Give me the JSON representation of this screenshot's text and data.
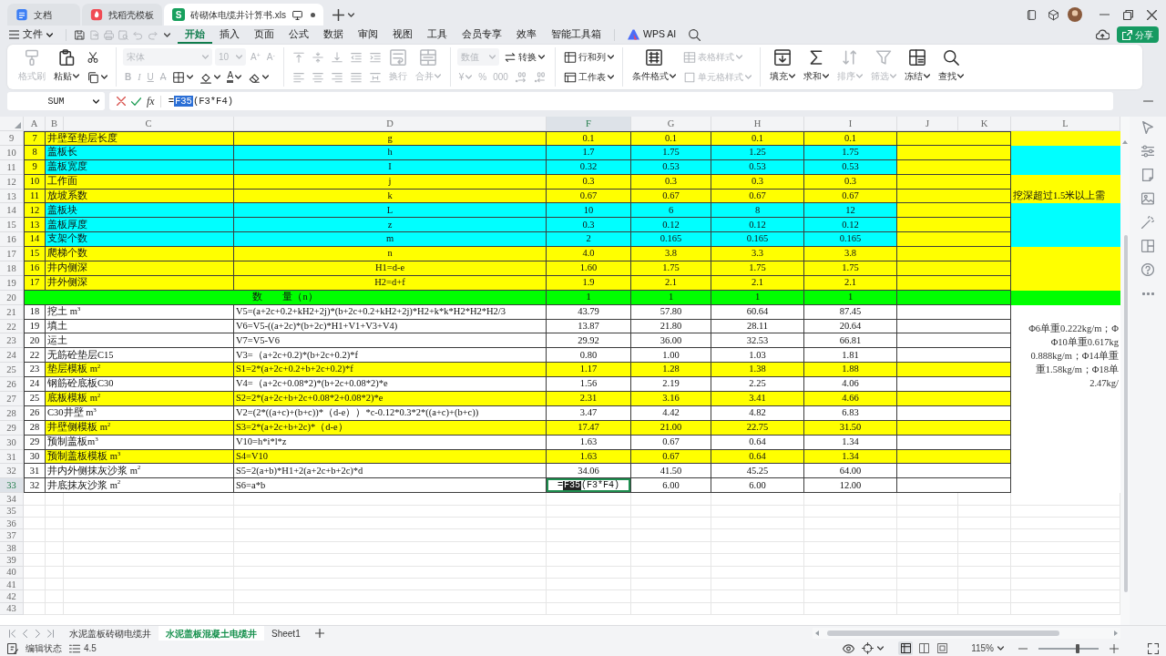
{
  "window_tabs": [
    {
      "kind": "doc",
      "label": "文档",
      "selected": false
    },
    {
      "kind": "template",
      "label": "找稻壳模板",
      "selected": false
    },
    {
      "kind": "sheet",
      "badge": "S",
      "label": "砖砌体电缆井计算书.xls",
      "selected": true
    }
  ],
  "menu": {
    "file": "文件",
    "quick_access": [
      {
        "disabled": false
      },
      {
        "disabled": true
      },
      {
        "disabled": true
      },
      {
        "disabled": true
      },
      {
        "disabled": true
      },
      {
        "disabled": true
      }
    ],
    "tabs": [
      {
        "label": "开始",
        "selected": true
      },
      {
        "label": "插入",
        "selected": false
      },
      {
        "label": "页面",
        "selected": false
      },
      {
        "label": "公式",
        "selected": false
      },
      {
        "label": "数据",
        "selected": false
      },
      {
        "label": "审阅",
        "selected": false
      },
      {
        "label": "视图",
        "selected": false
      },
      {
        "label": "工具",
        "selected": false
      },
      {
        "label": "会员专享",
        "selected": false
      },
      {
        "label": "效率",
        "selected": false
      },
      {
        "label": "智能工具箱",
        "selected": false
      }
    ],
    "ai": "WPS AI",
    "share": "分享"
  },
  "ribbon": [
    {
      "parts": [
        {
          "kind": "large",
          "label": "格式刷",
          "disabled": true
        },
        {
          "kind": "large",
          "label": "粘贴",
          "disabled": false,
          "dropdown": true
        },
        {
          "kind": "stack",
          "top": [
            {
              "kind": "icon",
              "disabled": false
            }
          ],
          "bottom": [
            {
              "kind": "icon",
              "disabled": false,
              "dropdown": true
            }
          ]
        }
      ]
    },
    {
      "parts": [
        {
          "kind": "stack",
          "top": [
            {
              "kind": "field",
              "value": "宋体",
              "disabled": true,
              "dropdown": true
            },
            {
              "kind": "field",
              "value": "10",
              "disabled": true,
              "dropdown": true
            },
            {
              "kind": "glyph",
              "text": "A$^{+}$",
              "disabled": true
            },
            {
              "kind": "glyph",
              "text": "A$^{-}$",
              "disabled": true
            }
          ],
          "bottom": [
            {
              "kind": "glyph",
              "text": "B",
              "disabled": true
            },
            {
              "kind": "glyph",
              "text": "I",
              "disabled": true
            },
            {
              "kind": "glyph",
              "text": "U",
              "disabled": true
            },
            {
              "kind": "glyph",
              "text": "A",
              "disabled": true
            },
            {
              "kind": "icon",
              "disabled": false,
              "dropdown": true
            },
            {
              "kind": "icon",
              "disabled": false,
              "dropdown": true
            },
            {
              "kind": "glyph",
              "text": "A",
              "disabled": false,
              "dropdown": true
            },
            {
              "kind": "icon",
              "disabled": false,
              "dropdown": true
            }
          ]
        }
      ]
    },
    {
      "parts": [
        {
          "kind": "stack",
          "top": [
            {
              "kind": "icon",
              "disabled": true
            },
            {
              "kind": "icon",
              "disabled": true
            },
            {
              "kind": "icon",
              "disabled": true
            },
            {
              "kind": "icon",
              "disabled": true
            },
            {
              "kind": "icon",
              "disabled": true
            }
          ],
          "bottom": [
            {
              "kind": "icon",
              "disabled": true
            },
            {
              "kind": "icon",
              "disabled": true
            },
            {
              "kind": "icon",
              "disabled": true
            },
            {
              "kind": "icon",
              "disabled": true
            },
            {
              "kind": "icon",
              "disabled": true
            }
          ]
        },
        {
          "kind": "large",
          "label": "换行",
          "disabled": true
        },
        {
          "kind": "large",
          "label": "合并",
          "disabled": true,
          "dropdown": true
        }
      ]
    },
    {
      "parts": [
        {
          "kind": "stack",
          "top": [
            {
              "kind": "field",
              "value": "数值",
              "disabled": true,
              "dropdown": true
            },
            {
              "kind": "small",
              "label": "转换",
              "disabled": false,
              "dropdown": true
            }
          ],
          "bottom": [
            {
              "kind": "glyph",
              "text": "¥",
              "disabled": true,
              "dropdown": true
            },
            {
              "kind": "glyph",
              "text": "%",
              "disabled": true
            },
            {
              "kind": "glyph",
              "text": "000",
              "disabled": true
            },
            {
              "kind": "icon",
              "disabled": true
            },
            {
              "kind": "icon",
              "disabled": true
            }
          ]
        }
      ]
    },
    {
      "parts": [
        {
          "kind": "stack",
          "top": [
            {
              "kind": "small",
              "label": "行和列",
              "disabled": false,
              "dropdown": true
            }
          ],
          "bottom": [
            {
              "kind": "small",
              "label": "工作表",
              "disabled": false,
              "dropdown": true
            }
          ]
        }
      ]
    },
    {
      "parts": [
        {
          "kind": "large",
          "label": "条件格式",
          "disabled": false,
          "dropdown": true
        },
        {
          "kind": "stack",
          "top": [
            {
              "kind": "small",
              "label": "表格样式",
              "disabled": true,
              "dropdown": true
            }
          ],
          "bottom": [
            {
              "kind": "small",
              "label": "单元格样式",
              "disabled": true,
              "dropdown": true
            }
          ]
        }
      ]
    },
    {
      "parts": [
        {
          "kind": "large",
          "label": "填充",
          "disabled": false,
          "dropdown": true
        },
        {
          "kind": "large",
          "label": "求和",
          "disabled": false,
          "dropdown": true
        },
        {
          "kind": "large",
          "label": "排序",
          "disabled": true,
          "dropdown": true
        },
        {
          "kind": "large",
          "label": "筛选",
          "disabled": true,
          "dropdown": true
        },
        {
          "kind": "large",
          "label": "冻结",
          "disabled": false,
          "dropdown": true
        },
        {
          "kind": "large",
          "label": "查找",
          "disabled": false,
          "dropdown": true
        }
      ]
    }
  ],
  "formula_bar": {
    "name_box": "SUM",
    "fx": "fx",
    "formula": [
      {
        "text": "=",
        "selected": false
      },
      {
        "text": "F35",
        "selected": true
      },
      {
        "text": "(F3*F4)",
        "selected": false
      }
    ]
  },
  "columns": [
    {
      "label": "A",
      "selected": false
    },
    {
      "label": "B",
      "selected": false
    },
    {
      "label": "C",
      "selected": false
    },
    {
      "label": "D",
      "selected": false
    },
    {
      "label": "F",
      "selected": true
    },
    {
      "label": "G",
      "selected": false
    },
    {
      "label": "H",
      "selected": false
    },
    {
      "label": "I",
      "selected": false
    },
    {
      "label": "J",
      "selected": false
    },
    {
      "label": "K",
      "selected": false
    },
    {
      "label": "L",
      "selected": false
    }
  ],
  "rows": [
    {
      "kind": "parameter",
      "row": "9",
      "selected": false,
      "no": "7",
      "item": "井壁至垫层长度",
      "symbol": "g",
      "values": [
        "0.1",
        "0.1",
        "0.1",
        "0.1"
      ],
      "color": "#ffff00",
      "edge": {
        "color": "#ffff00"
      },
      "side": {
        "color": "#ffff00"
      }
    },
    {
      "kind": "parameter",
      "row": "10",
      "selected": false,
      "no": "8",
      "item": "盖板长",
      "symbol": "h",
      "values": [
        "1.7",
        "1.75",
        "1.25",
        "1.75"
      ],
      "color": "#00ffff",
      "edge": {
        "color": "#ffff00"
      },
      "side": {
        "color": "#00ffff"
      }
    },
    {
      "kind": "parameter",
      "row": "11",
      "selected": false,
      "no": "9",
      "item": "盖板宽度",
      "symbol": "I",
      "values": [
        "0.32",
        "0.53",
        "0.53",
        "0.53"
      ],
      "color": "#00ffff",
      "edge": {
        "color": "#ffff00"
      },
      "side": {
        "color": "#00ffff"
      }
    },
    {
      "kind": "parameter",
      "row": "12",
      "selected": false,
      "no": "10",
      "item": "工作面",
      "symbol": "j",
      "values": [
        "0.3",
        "0.3",
        "0.3",
        "0.3"
      ],
      "color": "#ffff00",
      "edge": {
        "color": "#ffff00"
      },
      "side": {
        "color": "#ffff00"
      }
    },
    {
      "kind": "parameter",
      "row": "13",
      "selected": false,
      "no": "11",
      "item": "放坡系数",
      "symbol": "k",
      "values": [
        "0.67",
        "0.67",
        "0.67",
        "0.67"
      ],
      "color": "#ffff00",
      "edge": {
        "color": "#ffff00"
      },
      "side": {
        "color": "#ffff00",
        "text": "挖深超过1.5米以上需"
      }
    },
    {
      "kind": "parameter",
      "row": "14",
      "selected": false,
      "no": "12",
      "item": "盖板块",
      "symbol": "L",
      "values": [
        "10",
        "6",
        "8",
        "12"
      ],
      "color": "#00ffff",
      "edge": {
        "color": "#ffff00"
      },
      "side": {
        "color": "#00ffff"
      }
    },
    {
      "kind": "parameter",
      "row": "15",
      "selected": false,
      "no": "13",
      "item": "盖板厚度",
      "symbol": "z",
      "values": [
        "0.3",
        "0.12",
        "0.12",
        "0.12"
      ],
      "color": "#00ffff",
      "edge": {
        "color": "#ffff00"
      },
      "side": {
        "color": "#00ffff"
      }
    },
    {
      "kind": "parameter",
      "row": "16",
      "selected": false,
      "no": "14",
      "item": "支架个数",
      "symbol": "m",
      "values": [
        "2",
        "0.165",
        "0.165",
        "0.165"
      ],
      "color": "#00ffff",
      "edge": {
        "color": "#ffff00"
      },
      "side": {
        "color": "#00ffff"
      }
    },
    {
      "kind": "parameter",
      "row": "17",
      "selected": false,
      "no": "15",
      "item": "爬梯个数",
      "symbol": "n",
      "values": [
        "4.0",
        "3.8",
        "3.3",
        "3.8"
      ],
      "color": "#ffff00",
      "edge": {
        "color": "#ffff00"
      },
      "side": {
        "color": "#ffff00"
      }
    },
    {
      "kind": "parameter",
      "row": "18",
      "selected": false,
      "no": "16",
      "item": "井内侧深",
      "symbol": "H1=d-e",
      "values": [
        "1.60",
        "1.75",
        "1.75",
        "1.75"
      ],
      "color": "#ffff00",
      "edge": {
        "color": "#ffff00"
      },
      "side": {
        "color": "#ffff00"
      }
    },
    {
      "kind": "parameter",
      "row": "19",
      "selected": false,
      "no": "17",
      "item": "井外侧深",
      "symbol": "H2=d+f",
      "values": [
        "1.9",
        "2.1",
        "2.1",
        "2.1"
      ],
      "color": "#ffff00",
      "edge": {
        "color": "#ffff00"
      },
      "side": {
        "color": "#ffff00"
      }
    },
    {
      "kind": "total",
      "row": "20",
      "selected": false,
      "label": "数　　量（n）",
      "values": [
        "1",
        "1",
        "1",
        "1"
      ],
      "color": "#00ff00"
    },
    {
      "kind": "quantity",
      "row": "21",
      "selected": false,
      "no": "18",
      "item": "挖土 m$^{3}$",
      "formula": "V5=(a+2c+0.2+kH2+2j)*(b+2c+0.2+kH2+2j)*H2+k*k*H2*H2*H2/3",
      "values": [
        "43.79",
        "57.80",
        "60.64",
        "87.45"
      ],
      "color": "#ffffff"
    },
    {
      "kind": "quantity",
      "row": "22",
      "selected": false,
      "no": "19",
      "item": "填土",
      "formula": "V6=V5-((a+2c)*(b+2c)*H1+V1+V3+V4)",
      "values": [
        "13.87",
        "21.80",
        "28.11",
        "20.64"
      ],
      "color": "#ffffff"
    },
    {
      "kind": "quantity",
      "row": "23",
      "selected": false,
      "no": "20",
      "item": "运土",
      "formula": "V7=V5-V6",
      "values": [
        "29.92",
        "36.00",
        "32.53",
        "66.81"
      ],
      "color": "#ffffff"
    },
    {
      "kind": "quantity",
      "row": "24",
      "selected": false,
      "no": "22",
      "item": "无筋砼垫层C15",
      "formula": "V3=（a+2c+0.2)*(b+2c+0.2)*f",
      "values": [
        "0.80",
        "1.00",
        "1.03",
        "1.81"
      ],
      "color": "#ffffff"
    },
    {
      "kind": "quantity",
      "row": "25",
      "selected": false,
      "no": "23",
      "item": "垫层模板 m$^{2}$",
      "formula": "S1=2*(a+2c+0.2+b+2c+0.2)*f",
      "values": [
        "1.17",
        "1.28",
        "1.38",
        "1.88"
      ],
      "color": "#ffff00"
    },
    {
      "kind": "quantity",
      "row": "26",
      "selected": false,
      "no": "24",
      "item": "钢筋砼底板C30",
      "formula": "V4=（a+2c+0.08*2)*(b+2c+0.08*2)*e",
      "values": [
        "1.56",
        "2.19",
        "2.25",
        "4.06"
      ],
      "color": "#ffffff"
    },
    {
      "kind": "quantity",
      "row": "27",
      "selected": false,
      "no": "25",
      "item": "底板模板 m$^{2}$",
      "formula": "S2=2*(a+2c+b+2c+0.08*2+0.08*2)*e",
      "values": [
        "2.31",
        "3.16",
        "3.41",
        "4.66"
      ],
      "color": "#ffff00"
    },
    {
      "kind": "quantity",
      "row": "28",
      "selected": false,
      "no": "26",
      "item": "C30井壁 m$^{3}$",
      "formula": "V2=(2*((a+c)+(b+c))*（d-e））*c-0.12*0.3*2*((a+c)+(b+c))",
      "values": [
        "3.47",
        "4.42",
        "4.82",
        "6.83"
      ],
      "color": "#ffffff"
    },
    {
      "kind": "quantity",
      "row": "29",
      "selected": false,
      "no": "28",
      "item": "井壁侧模板 m$^{2}$",
      "formula": "S3=2*(a+2c+b+2c)*（d-e）",
      "values": [
        "17.47",
        "21.00",
        "22.75",
        "31.50"
      ],
      "color": "#ffff00"
    },
    {
      "kind": "quantity",
      "row": "30",
      "selected": false,
      "no": "29",
      "item": "预制盖板m$^{3}$",
      "formula": "V10=h*i*l*z",
      "values": [
        "1.63",
        "0.67",
        "0.64",
        "1.34"
      ],
      "color": "#ffffff"
    },
    {
      "kind": "quantity",
      "row": "31",
      "selected": false,
      "no": "30",
      "item": "预制盖板模板 m$^{3}$",
      "formula": "S4=V10",
      "values": [
        "1.63",
        "0.67",
        "0.64",
        "1.34"
      ],
      "color": "#ffff00"
    },
    {
      "kind": "quantity",
      "row": "32",
      "selected": false,
      "no": "31",
      "item": "井内外侧抹灰沙浆 m$^{2}$",
      "formula": "S5=2(a+b)*H1+2(a+2c+b+2c)*d",
      "values": [
        "34.06",
        "41.50",
        "45.25",
        "64.00"
      ],
      "color": "#ffffff"
    },
    {
      "kind": "quantity",
      "row": "33",
      "selected": true,
      "no": "32",
      "item": "井底抹灰沙浆 m$^{2}$",
      "formula": "S6=a*b",
      "values": [
        {
          "editing": true,
          "parts": [
            {
              "text": "=",
              "selected": false
            },
            {
              "text": "F35",
              "selected": true
            },
            {
              "text": "(F3*F4)",
              "selected": false
            }
          ]
        },
        "6.00",
        "6.00",
        "12.00"
      ],
      "color": "#ffffff"
    }
  ],
  "side_note": {
    "lines": [
      "Φ6单重0.222kg/m；Φ",
      "Φ10单重0.617kg",
      "0.888kg/m；Φ14单重",
      "重1.58kg/m；Φ18单",
      "2.47kg/"
    ]
  },
  "blank_rows": [
    "34",
    "35",
    "36",
    "37",
    "38",
    "39",
    "40",
    "41",
    "42",
    "43"
  ],
  "sheet_tabs": [
    {
      "label": "水泥盖板砖砌电缆井",
      "selected": false
    },
    {
      "label": "水泥盖板混凝土电缆井",
      "selected": true
    },
    {
      "label": "Sheet1",
      "selected": false
    }
  ],
  "status_bar": {
    "mode": "编辑状态",
    "value": "4.5",
    "views": [
      {
        "selected": true
      },
      {
        "selected": false
      },
      {
        "selected": false
      }
    ],
    "zoom": "115%",
    "zoom_slider": {
      "level": 0.65
    }
  }
}
